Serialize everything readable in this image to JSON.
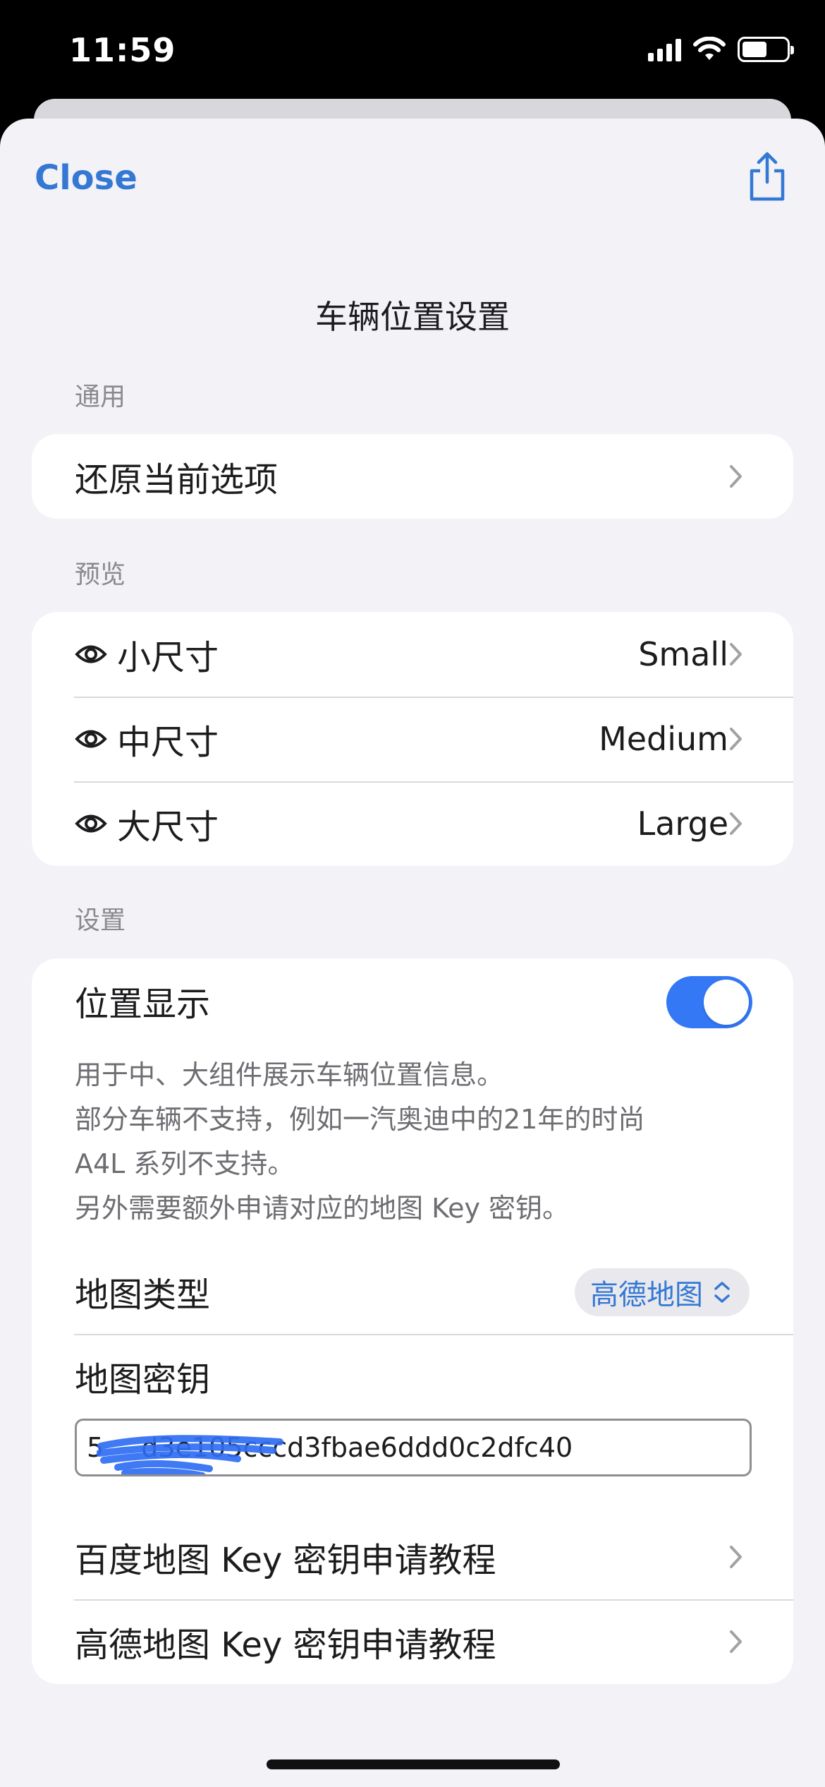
{
  "status": {
    "time": "11:59"
  },
  "nav": {
    "close": "Close",
    "share_icon": "share-icon"
  },
  "title": "车辆位置设置",
  "general": {
    "header": "通用",
    "restore": "还原当前选项"
  },
  "preview": {
    "header": "预览",
    "items": [
      {
        "label": "小尺寸",
        "value": "Small"
      },
      {
        "label": "中尺寸",
        "value": "Medium"
      },
      {
        "label": "大尺寸",
        "value": "Large"
      }
    ]
  },
  "settings": {
    "header": "设置",
    "location_display": "位置显示",
    "location_toggle_on": true,
    "desc_lines": [
      "用于中、大组件展示车辆位置信息。",
      "部分车辆不支持，例如一汽奥迪中的21年的时尚",
      "A4L 系列不支持。",
      "另外需要额外申请对应的地图 Key 密钥。"
    ],
    "map_type_label": "地图类型",
    "map_type_value": "高德地图",
    "map_key_label": "地图密钥",
    "map_key_value": "5       d3e105cccd3fbae6ddd0c2dfc40",
    "baidu_tutorial": "百度地图 Key 密钥申请教程",
    "amap_tutorial": "高德地图 Key 密钥申请教程"
  },
  "colors": {
    "accent": "#3478d4",
    "toggle": "#3478f6",
    "background": "#f2f2f7"
  }
}
